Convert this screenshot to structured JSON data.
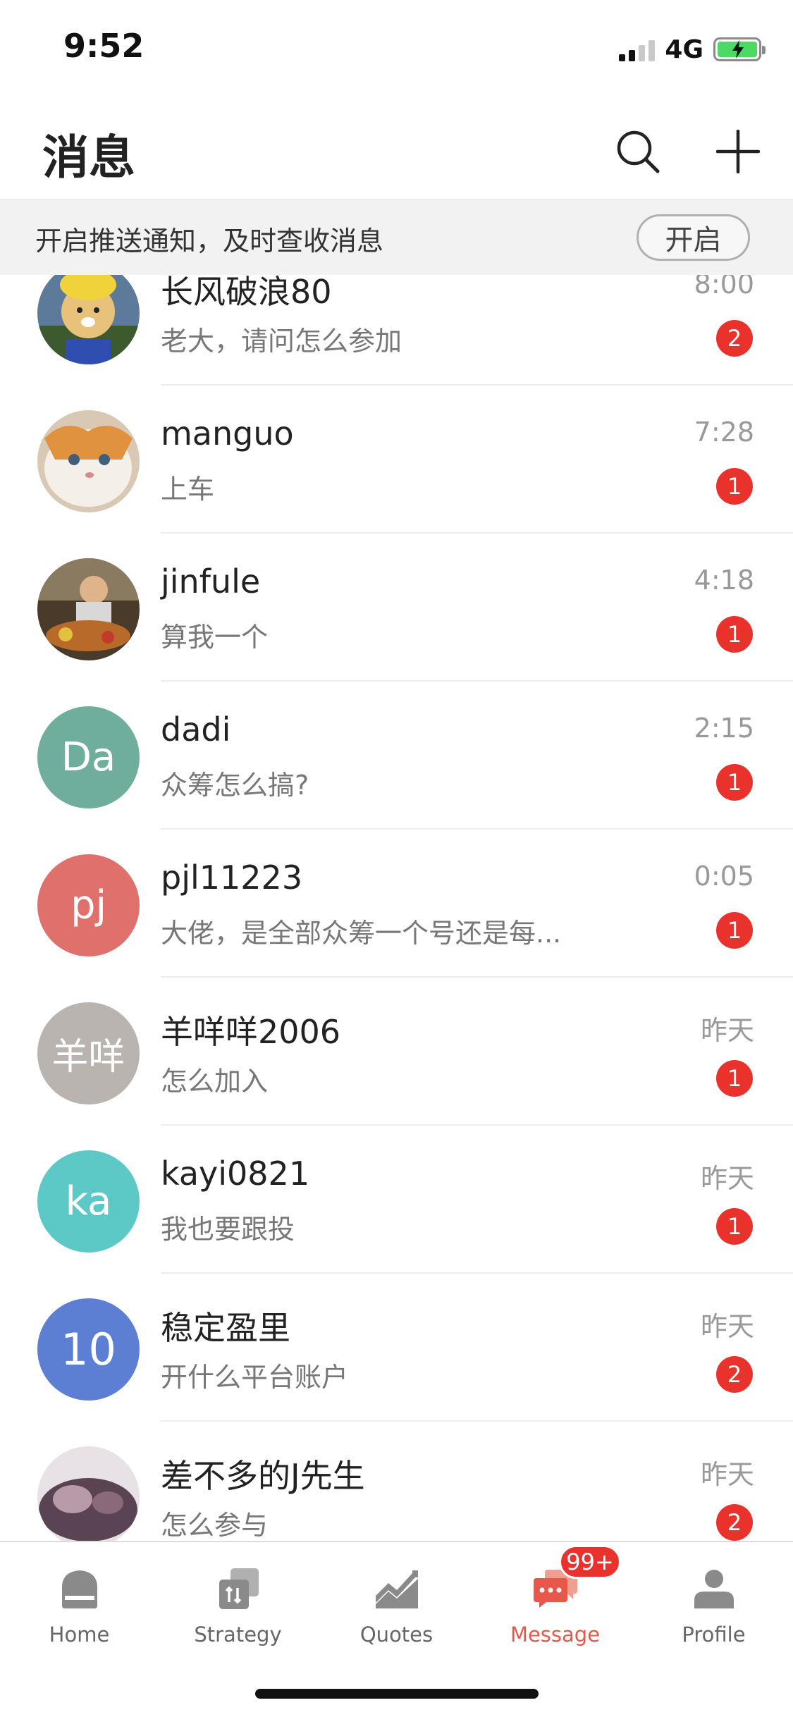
{
  "status_bar": {
    "time": "9:52",
    "network": "4G"
  },
  "header": {
    "title": "消息"
  },
  "notify": {
    "text": "开启推送通知，及时查收消息",
    "button_label": "开启"
  },
  "conversations": [
    {
      "name": "长风破浪80",
      "preview": "老大，请问怎么参加",
      "time": "8:00",
      "unread": "2",
      "avatar_initials": "",
      "avatar_color": "#c6a24a"
    },
    {
      "name": "manguo",
      "preview": "上车",
      "time": "7:28",
      "unread": "1",
      "avatar_initials": "",
      "avatar_color": "#cfa47a"
    },
    {
      "name": "jinfule",
      "preview": "算我一个",
      "time": "4:18",
      "unread": "1",
      "avatar_initials": "",
      "avatar_color": "#7a5a3c"
    },
    {
      "name": "dadi",
      "preview": "众筹怎么搞?",
      "time": "2:15",
      "unread": "1",
      "avatar_initials": "Da",
      "avatar_color": "#6fae9d"
    },
    {
      "name": "pjl11223",
      "preview": "大佬，是全部众筹一个号还是每...",
      "time": "0:05",
      "unread": "1",
      "avatar_initials": "pj",
      "avatar_color": "#e0706b"
    },
    {
      "name": "羊咩咩2006",
      "preview": "怎么加入",
      "time": "昨天",
      "unread": "1",
      "avatar_initials": "羊咩",
      "avatar_color": "#b9b4b0"
    },
    {
      "name": "kayi0821",
      "preview": "我也要跟投",
      "time": "昨天",
      "unread": "1",
      "avatar_initials": "ka",
      "avatar_color": "#5dc9c6"
    },
    {
      "name": "稳定盈里",
      "preview": "开什么平台账户",
      "time": "昨天",
      "unread": "2",
      "avatar_initials": "10",
      "avatar_color": "#5c7fd3"
    },
    {
      "name": "差不多的J先生",
      "preview": "怎么参与",
      "time": "昨天",
      "unread": "2",
      "avatar_initials": "",
      "avatar_color": "#6b5566"
    }
  ],
  "tabs": [
    {
      "label": "Home",
      "icon": "home-icon"
    },
    {
      "label": "Strategy",
      "icon": "strategy-icon"
    },
    {
      "label": "Quotes",
      "icon": "quotes-icon"
    },
    {
      "label": "Message",
      "icon": "message-icon",
      "badge": "99+"
    },
    {
      "label": "Profile",
      "icon": "profile-icon"
    }
  ],
  "colors": {
    "accent": "#e8574a",
    "badge": "#e8322b",
    "tab_icon": "#8a8a8a"
  }
}
